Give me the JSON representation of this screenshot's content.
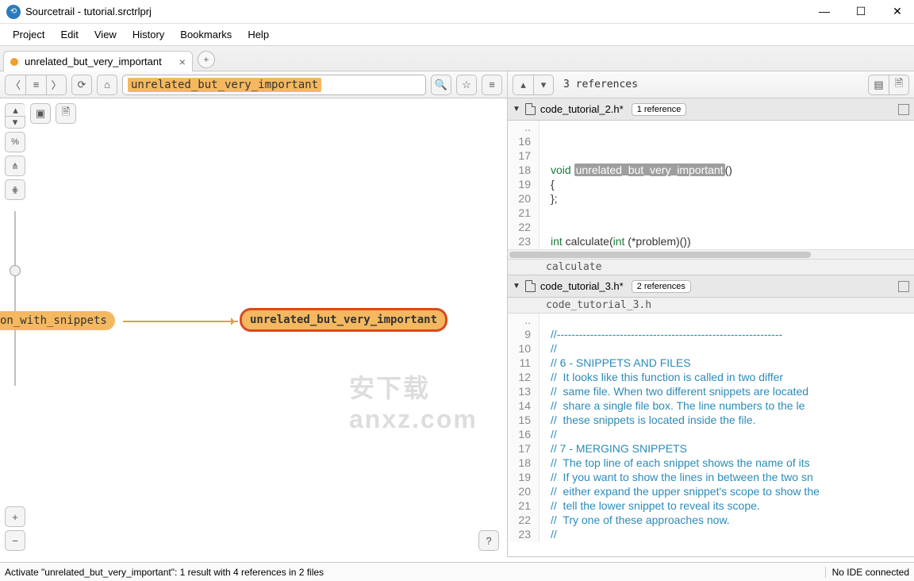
{
  "window": {
    "title": "Sourcetrail - tutorial.srctrlprj"
  },
  "menu": {
    "items": [
      "Project",
      "Edit",
      "View",
      "History",
      "Bookmarks",
      "Help"
    ]
  },
  "tab": {
    "label": "unrelated_but_very_important"
  },
  "search": {
    "value": "unrelated_but_very_important"
  },
  "graph": {
    "source_node": "on_with_snippets",
    "target_node": "unrelated_but_very_important"
  },
  "code_header": {
    "total_refs": "3 references"
  },
  "file1": {
    "name": "code_tutorial_2.h*",
    "refs": "1 reference",
    "lines": [
      {
        "n": "..",
        "body": ""
      },
      {
        "n": "16",
        "body": ""
      },
      {
        "n": "17",
        "body": ""
      },
      {
        "n": "18",
        "body_html": "<span class='kw'>void</span> <span class='hl'>unrelated_but_very_important</span>()"
      },
      {
        "n": "19",
        "body": "{"
      },
      {
        "n": "20",
        "body": "};"
      },
      {
        "n": "21",
        "body": ""
      },
      {
        "n": "22",
        "body": ""
      },
      {
        "n": "23",
        "body_html": "<span class='kw'>int</span> calculate(<span class='kw'>int</span> (*problem)())"
      }
    ],
    "scope": "calculate"
  },
  "file2": {
    "name": "code_tutorial_3.h*",
    "refs": "2 references",
    "scope_top": "code_tutorial_3.h",
    "lines": [
      {
        "n": "..",
        "body": ""
      },
      {
        "n": "9",
        "body_html": "<span class='cmt'>//-------------------------------------------------------------</span>"
      },
      {
        "n": "10",
        "body_html": "<span class='cmt'>//</span>"
      },
      {
        "n": "11",
        "body_html": "<span class='cmt'>// 6 - SNIPPETS AND FILES</span>"
      },
      {
        "n": "12",
        "body_html": "<span class='cmt'>//  It looks like this function is called in two differ</span>"
      },
      {
        "n": "13",
        "body_html": "<span class='cmt'>//  same file. When two different snippets are located </span>"
      },
      {
        "n": "14",
        "body_html": "<span class='cmt'>//  share a single file box. The line numbers to the le</span>"
      },
      {
        "n": "15",
        "body_html": "<span class='cmt'>//  these snippets is located inside the file.</span>"
      },
      {
        "n": "16",
        "body_html": "<span class='cmt'>//</span>"
      },
      {
        "n": "17",
        "body_html": "<span class='cmt'>// 7 - MERGING SNIPPETS</span>"
      },
      {
        "n": "18",
        "body_html": "<span class='cmt'>//  The top line of each snippet shows the name of its </span>"
      },
      {
        "n": "19",
        "body_html": "<span class='cmt'>//  If you want to show the lines in between the two sn</span>"
      },
      {
        "n": "20",
        "body_html": "<span class='cmt'>//  either expand the upper snippet's scope to show the</span>"
      },
      {
        "n": "21",
        "body_html": "<span class='cmt'>//  tell the lower snippet to reveal its scope.</span>"
      },
      {
        "n": "22",
        "body_html": "<span class='cmt'>//  Try one of these approaches now.</span>"
      },
      {
        "n": "23",
        "body_html": "<span class='cmt'>//</span>"
      }
    ]
  },
  "statusbar": {
    "left": "Activate \"unrelated_but_very_important\": 1 result with 4 references in 2 files",
    "right": "No IDE connected"
  }
}
